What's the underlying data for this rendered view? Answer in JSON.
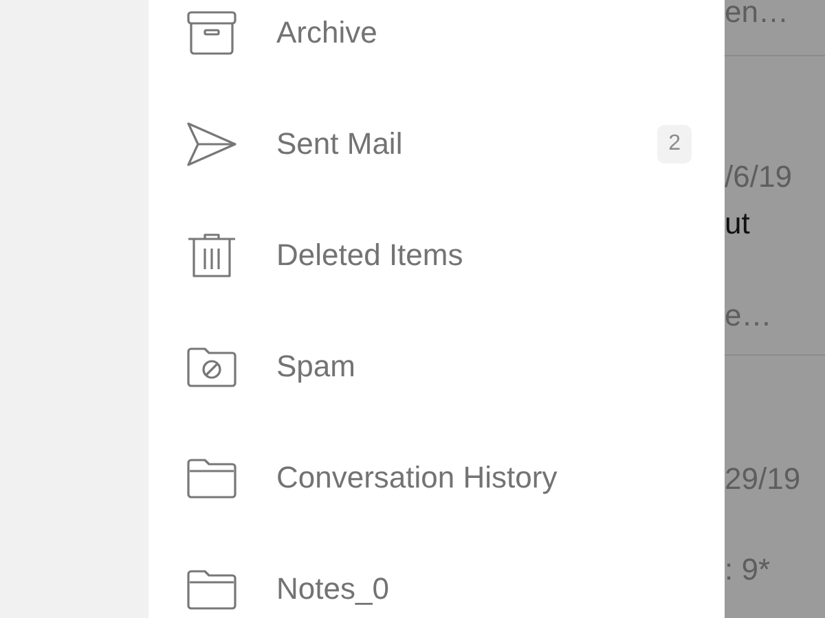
{
  "folders": [
    {
      "kind": "archive",
      "label": "Archive"
    },
    {
      "kind": "sent",
      "label": "Sent Mail",
      "count": "2"
    },
    {
      "kind": "trash",
      "label": "Deleted Items"
    },
    {
      "kind": "spam",
      "label": "Spam"
    },
    {
      "kind": "folder",
      "label": "Conversation History"
    },
    {
      "kind": "folder",
      "label": "Notes_0"
    }
  ],
  "background_messages": [
    {
      "kind": "preview",
      "text": "en…"
    },
    {
      "kind": "date",
      "text": "/6/19"
    },
    {
      "kind": "subject",
      "text": "ut"
    },
    {
      "kind": "preview",
      "text": "e…"
    },
    {
      "kind": "date",
      "text": "29/19"
    },
    {
      "kind": "preview",
      "text": ": 9*"
    }
  ]
}
